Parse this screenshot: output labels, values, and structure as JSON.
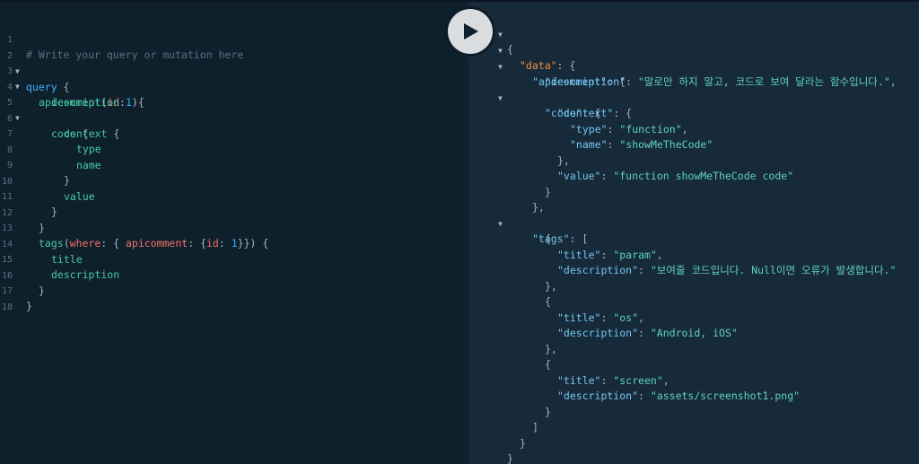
{
  "editor": {
    "line_numbers": [
      "1",
      "2",
      "3",
      "4",
      "5",
      "6",
      "7",
      "8",
      "9",
      "10",
      "11",
      "12",
      "13",
      "14",
      "15",
      "16",
      "17",
      "18"
    ],
    "comment": "# Write your query or mutation here",
    "query_kw": "query",
    "field_apicomment": "apicomment",
    "arg_id": "id",
    "num_one": "1",
    "field_description": "description",
    "field_code": "code",
    "field_context": "context",
    "field_type": "type",
    "field_name": "name",
    "field_value": "value",
    "field_tags": "tags",
    "arg_where": "where",
    "arg_apicomment": "apicomment",
    "field_title": "title"
  },
  "toolbar": {
    "run_icon": "play-icon"
  },
  "result": {
    "key_data": "\"data\"",
    "key_apicomment": "\"apicomment\"",
    "key_description": "\"description\"",
    "val_description": "\"말로만 하지 말고, 코드로 보여 달라는 함수입니다.\"",
    "key_code": "\"code\"",
    "key_context": "\"context\"",
    "key_type": "\"type\"",
    "val_type": "\"function\"",
    "key_name": "\"name\"",
    "val_name": "\"showMeTheCode\"",
    "key_value": "\"value\"",
    "val_value": "\"function showMeTheCode code\"",
    "key_tags": "\"tags\"",
    "key_title": "\"title\"",
    "tags": [
      {
        "title": "\"param\"",
        "description": "\"보여줄 코드입니다. Null이면 오류가 발생합니다.\""
      },
      {
        "title": "\"os\"",
        "description": "\"Android, iOS\""
      },
      {
        "title": "\"screen\"",
        "description": "\"assets/screenshot1.png\""
      }
    ]
  }
}
